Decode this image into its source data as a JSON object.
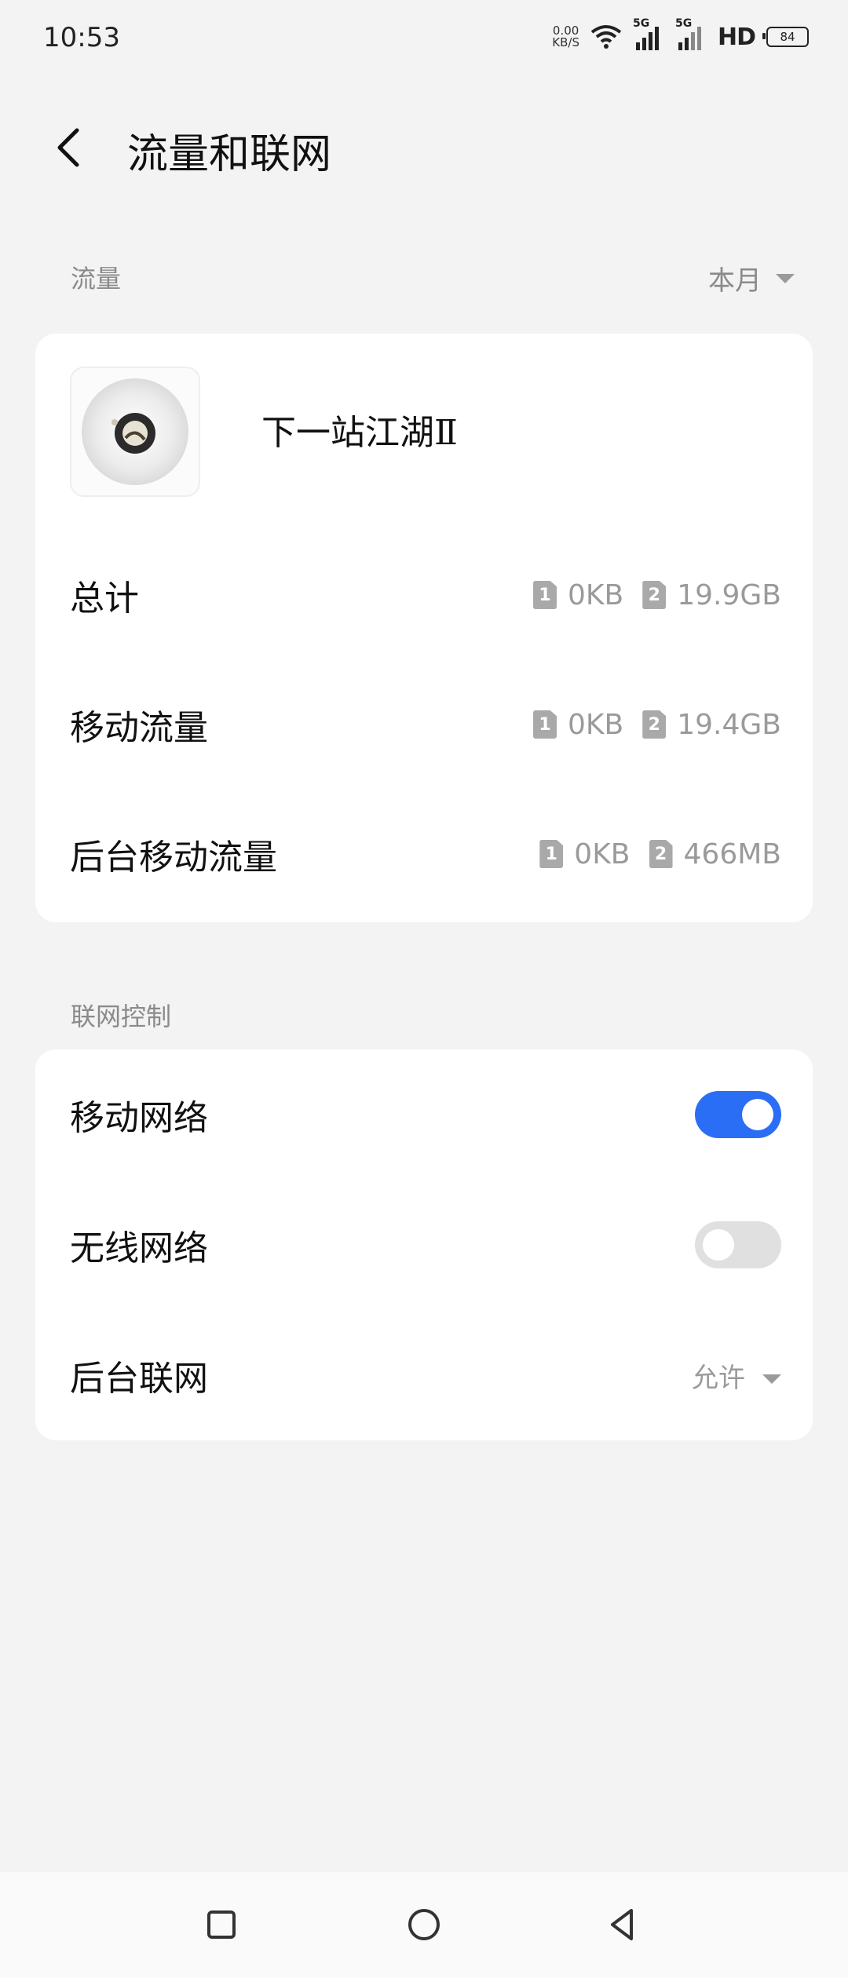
{
  "status_bar": {
    "time": "10:53",
    "net_speed_value": "0.00",
    "net_speed_unit": "KB/S",
    "sig1_label": "5G",
    "sig2_label": "5G",
    "hd_label": "HD",
    "battery": "84"
  },
  "header": {
    "title": "流量和联网"
  },
  "traffic_section": {
    "label": "流量",
    "period": "本月"
  },
  "app": {
    "name": "下一站江湖Ⅱ"
  },
  "usage_rows": [
    {
      "label": "总计",
      "sim1_badge": "1",
      "sim1_value": "0KB",
      "sim2_badge": "2",
      "sim2_value": "19.9GB"
    },
    {
      "label": "移动流量",
      "sim1_badge": "1",
      "sim1_value": "0KB",
      "sim2_badge": "2",
      "sim2_value": "19.4GB"
    },
    {
      "label": "后台移动流量",
      "sim1_badge": "1",
      "sim1_value": "0KB",
      "sim2_badge": "2",
      "sim2_value": "466MB"
    }
  ],
  "network_section": {
    "label": "联网控制",
    "mobile_network": {
      "label": "移动网络",
      "enabled": true
    },
    "wifi_network": {
      "label": "无线网络",
      "enabled": false
    },
    "background": {
      "label": "后台联网",
      "value": "允许"
    }
  },
  "colors": {
    "accent": "#2a6ef5",
    "background": "#f3f3f3",
    "card": "#ffffff",
    "secondary_text": "#9a9a9a"
  }
}
